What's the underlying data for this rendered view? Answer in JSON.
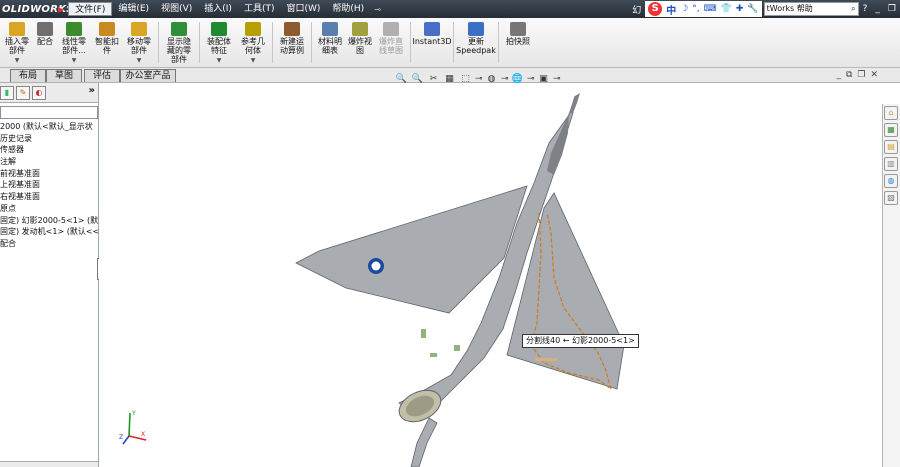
{
  "app": {
    "logo": "OLIDWORKS",
    "doc_prefix": "幻"
  },
  "menu": [
    {
      "label": "文件(F)",
      "active": true
    },
    {
      "label": "编辑(E)"
    },
    {
      "label": "视图(V)"
    },
    {
      "label": "插入(I)"
    },
    {
      "label": "工具(T)"
    },
    {
      "label": "窗口(W)"
    },
    {
      "label": "帮助(H)"
    }
  ],
  "menu_pin": "⊸",
  "ime": {
    "zh": "中",
    "icons": [
      "☽",
      "°,",
      "⌨",
      "👕",
      "✚",
      "🔧"
    ]
  },
  "help_search": {
    "value": "tWorks 帮助",
    "placeholder": "SolidWorks 帮助"
  },
  "window_buttons": {
    "help": "?",
    "min": "_",
    "restore": "❐"
  },
  "ribbon": [
    {
      "lines": [
        "插入零",
        "部件"
      ],
      "caret": true,
      "color": "#d8a624"
    },
    {
      "lines": [
        "配合"
      ],
      "caret": false,
      "color": "#6f6f6f"
    },
    {
      "lines": [
        "线性零",
        "部件..."
      ],
      "caret": true,
      "color": "#3b8a2c"
    },
    {
      "lines": [
        "智能扣",
        "件"
      ],
      "caret": false,
      "color": "#c88a20"
    },
    {
      "lines": [
        "移动零",
        "部件"
      ],
      "caret": true,
      "color": "#d8a624"
    },
    {
      "lines": [
        "显示隐",
        "藏的零",
        "部件"
      ],
      "caret": false,
      "color": "#2f8e3a",
      "sep_before": true
    },
    {
      "lines": [
        "装配体",
        "特征"
      ],
      "caret": true,
      "color": "#1f8a2f",
      "sep_before": true
    },
    {
      "lines": [
        "参考几",
        "何体"
      ],
      "caret": true,
      "color": "#b5a000"
    },
    {
      "lines": [
        "新建运",
        "动算例"
      ],
      "caret": false,
      "color": "#8c5a2c",
      "sep_before": true
    },
    {
      "lines": [
        "材料明",
        "细表"
      ],
      "caret": false,
      "color": "#5a7fae",
      "sep_before": true
    },
    {
      "lines": [
        "爆炸视",
        "图"
      ],
      "caret": false,
      "color": "#a0a040"
    },
    {
      "lines": [
        "爆炸直",
        "线草图"
      ],
      "caret": false,
      "color": "#b0b0b0",
      "disabled": true
    },
    {
      "lines": [
        "Instant3D"
      ],
      "caret": false,
      "color": "#4a6ec8",
      "sep_before": true
    },
    {
      "lines": [
        "更新",
        "Speedpak"
      ],
      "caret": false,
      "color": "#3a6fc8",
      "sep_before": true
    },
    {
      "lines": [
        "拍快照"
      ],
      "caret": false,
      "color": "#777777",
      "sep_before": true
    }
  ],
  "command_tabs": [
    "布局",
    "草图",
    "评估",
    "办公室产品"
  ],
  "left_panel": {
    "tabs": [
      "▮",
      "✎",
      "◐"
    ],
    "more": "»",
    "tree": [
      "2000 (默认<默认_显示状",
      "历史记录",
      "传感器",
      "注解",
      "前视基准面",
      "上视基准面",
      "右视基准面",
      "原点",
      "固定) 幻影2000-5<1> (默",
      "固定) 发动机<1> (默认<<",
      "配合"
    ],
    "splitter": "⋮"
  },
  "heads_up": [
    "🔍",
    "🔍",
    "✂",
    "▦",
    "⬚",
    "⊸",
    "◍",
    "⊸",
    "🌐",
    "⊸",
    "▣",
    "⊸"
  ],
  "viewport_controls": [
    "_",
    "⧉",
    "❐",
    "✕"
  ],
  "tooltip": "分割线40 ← 幻影2000-5<1>",
  "triad": {
    "x": "X",
    "y": "Y",
    "z": "Z"
  },
  "task_pane": [
    "⌂",
    "▦",
    "▤",
    "▥",
    "◍",
    "▧"
  ],
  "colors": {
    "aircraft": "#a9acb1",
    "aircraft_dark": "#7e8288",
    "outline": "#5e6369",
    "split_line": "#d07a1e",
    "roundel_blue": "#1e4a9e",
    "roundel_white": "#ffffff"
  }
}
